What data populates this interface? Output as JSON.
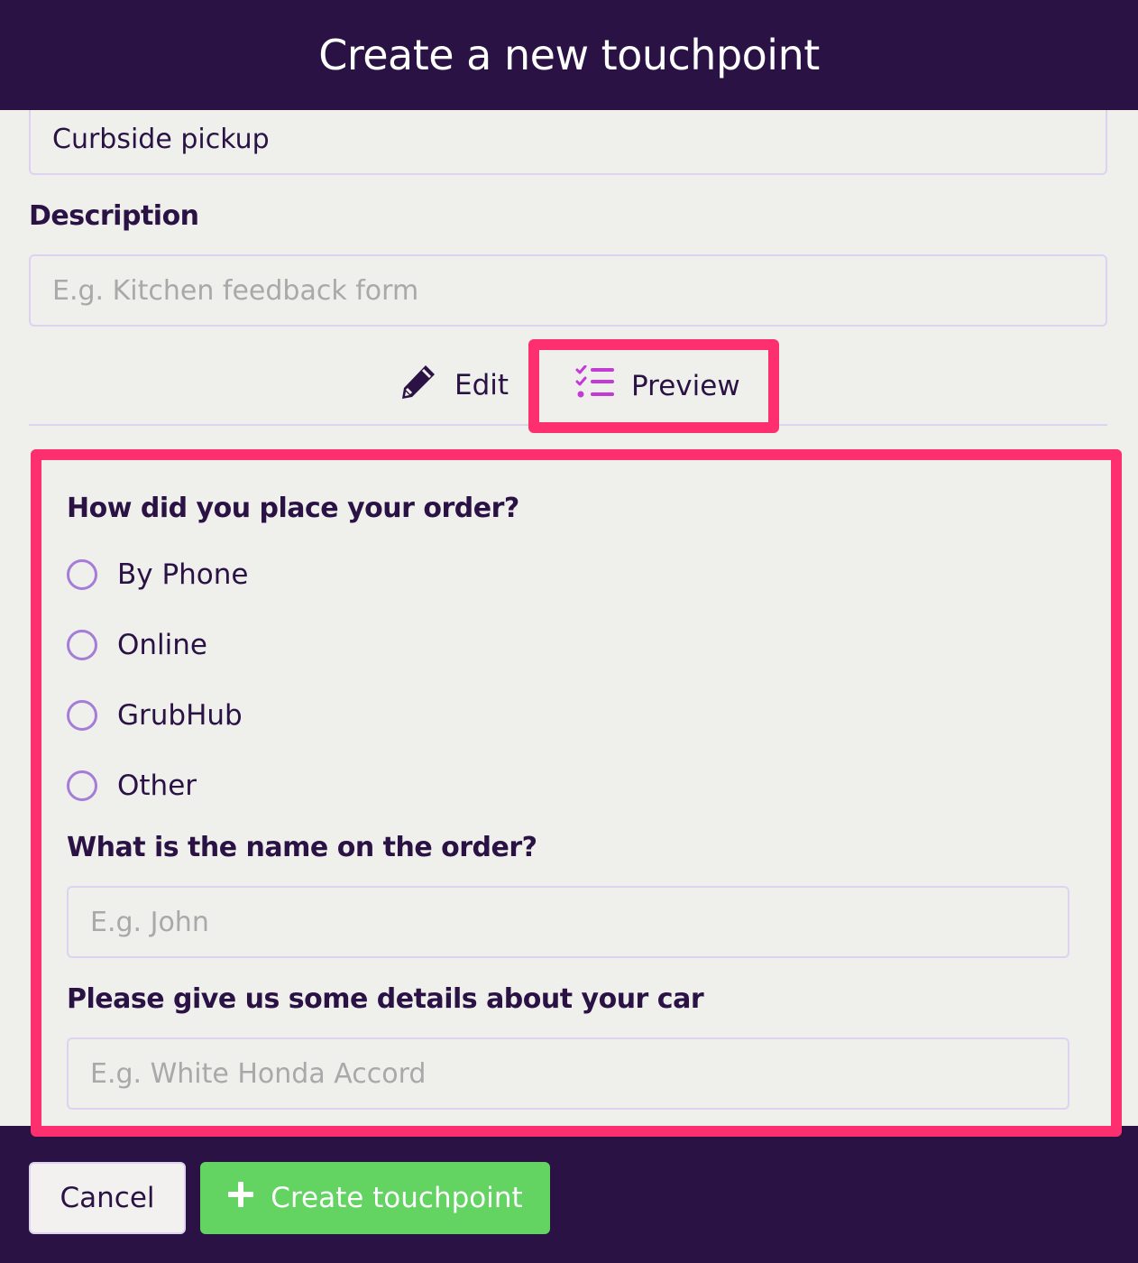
{
  "header": {
    "title": "Create a new touchpoint"
  },
  "form": {
    "name_value": "Curbside pickup",
    "description_label": "Description",
    "description_placeholder": "E.g. Kitchen feedback form"
  },
  "tabs": {
    "edit_label": "Edit",
    "preview_label": "Preview",
    "active": "preview"
  },
  "preview": {
    "q1": {
      "label": "How did you place your order?",
      "options": [
        "By Phone",
        "Online",
        "GrubHub",
        "Other"
      ]
    },
    "q2": {
      "label": "What is the name on the order?",
      "placeholder": "E.g. John"
    },
    "q3": {
      "label": "Please give us some details about your car",
      "placeholder": "E.g. White Honda Accord"
    }
  },
  "footer": {
    "cancel_label": "Cancel",
    "create_label": "Create touchpoint"
  },
  "colors": {
    "brand_dark": "#2a1244",
    "highlight": "#fe2f6e",
    "accent_purple": "#a57dd8",
    "preview_icon": "#c23bd4",
    "success": "#63d362"
  },
  "icons": {
    "edit": "pencil-icon",
    "preview": "checklist-icon",
    "create": "plus-icon"
  }
}
